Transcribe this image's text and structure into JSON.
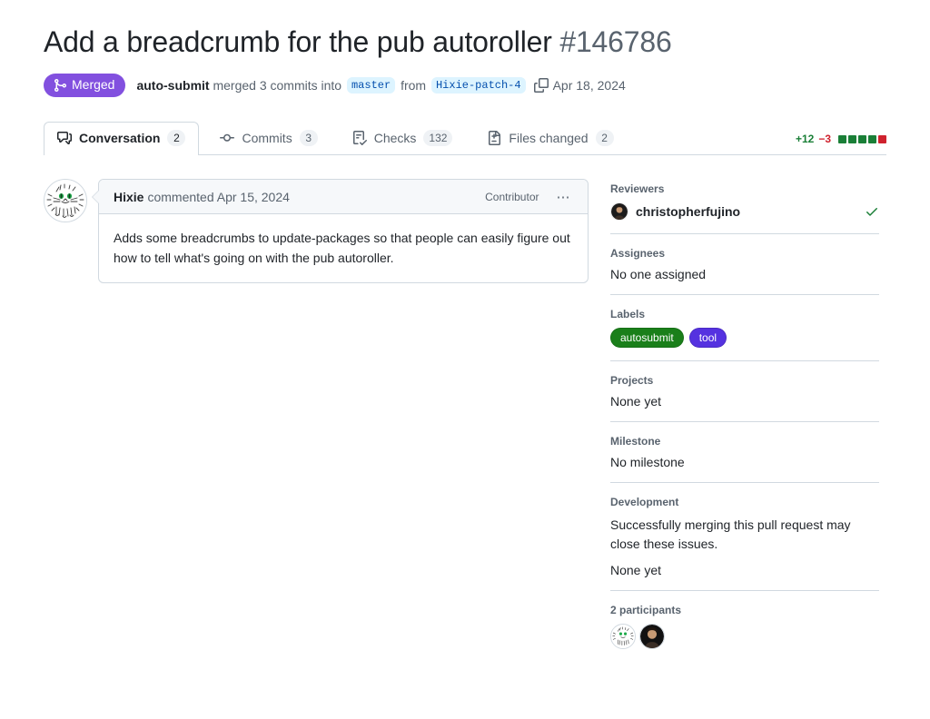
{
  "header": {
    "title": "Add a breadcrumb for the pub autoroller",
    "number": "#146786",
    "state": "Merged",
    "state_color": "#8250df",
    "actor": "auto-submit",
    "action_text": "merged 3 commits into",
    "base_branch": "master",
    "from_text": "from",
    "head_branch": "Hixie-patch-4",
    "date": "Apr 18, 2024",
    "copy_icon": "copy-icon",
    "merge_icon": "git-merge-icon"
  },
  "tabs": [
    {
      "label": "Conversation",
      "count": "2",
      "icon": "comment-discussion-icon",
      "selected": true
    },
    {
      "label": "Commits",
      "count": "3",
      "icon": "git-commit-icon",
      "selected": false
    },
    {
      "label": "Checks",
      "count": "132",
      "icon": "checklist-icon",
      "selected": false
    },
    {
      "label": "Files changed",
      "count": "2",
      "icon": "file-diff-icon",
      "selected": false
    }
  ],
  "diffstat": {
    "additions": "+12",
    "deletions": "−3",
    "additions_color": "#1a7f37",
    "deletions_color": "#cf222e",
    "blocks": [
      "g",
      "g",
      "g",
      "g",
      "r"
    ]
  },
  "comment": {
    "author": "Hixie",
    "action": "commented Apr 15, 2024",
    "association": "Contributor",
    "menu_icon": "kebab-horizontal-icon",
    "avatar_icon": "cat-sketch-avatar",
    "body": "Adds some breadcrumbs to update-packages so that people can easily figure out how to tell what's going on with the pub autoroller."
  },
  "sidebar": {
    "reviewers": {
      "title": "Reviewers",
      "people": [
        {
          "name": "christopherfujino",
          "approved": true,
          "check_icon": "check-icon",
          "avatar_icon": "person-photo-avatar"
        }
      ]
    },
    "assignees": {
      "title": "Assignees",
      "empty": "No one assigned"
    },
    "labels": {
      "title": "Labels",
      "items": [
        {
          "name": "autosubmit",
          "color": "#1a7f1a",
          "text_color": "#1f2328"
        },
        {
          "name": "tool",
          "color": "#5532e0",
          "text_color": "#1f2328"
        }
      ]
    },
    "projects": {
      "title": "Projects",
      "empty": "None yet"
    },
    "milestone": {
      "title": "Milestone",
      "empty": "No milestone"
    },
    "development": {
      "title": "Development",
      "note": "Successfully merging this pull request may close these issues.",
      "empty": "None yet"
    },
    "participants": {
      "title": "2 participants",
      "avatars": [
        "cat-sketch-avatar",
        "person-photo-avatar"
      ]
    }
  }
}
